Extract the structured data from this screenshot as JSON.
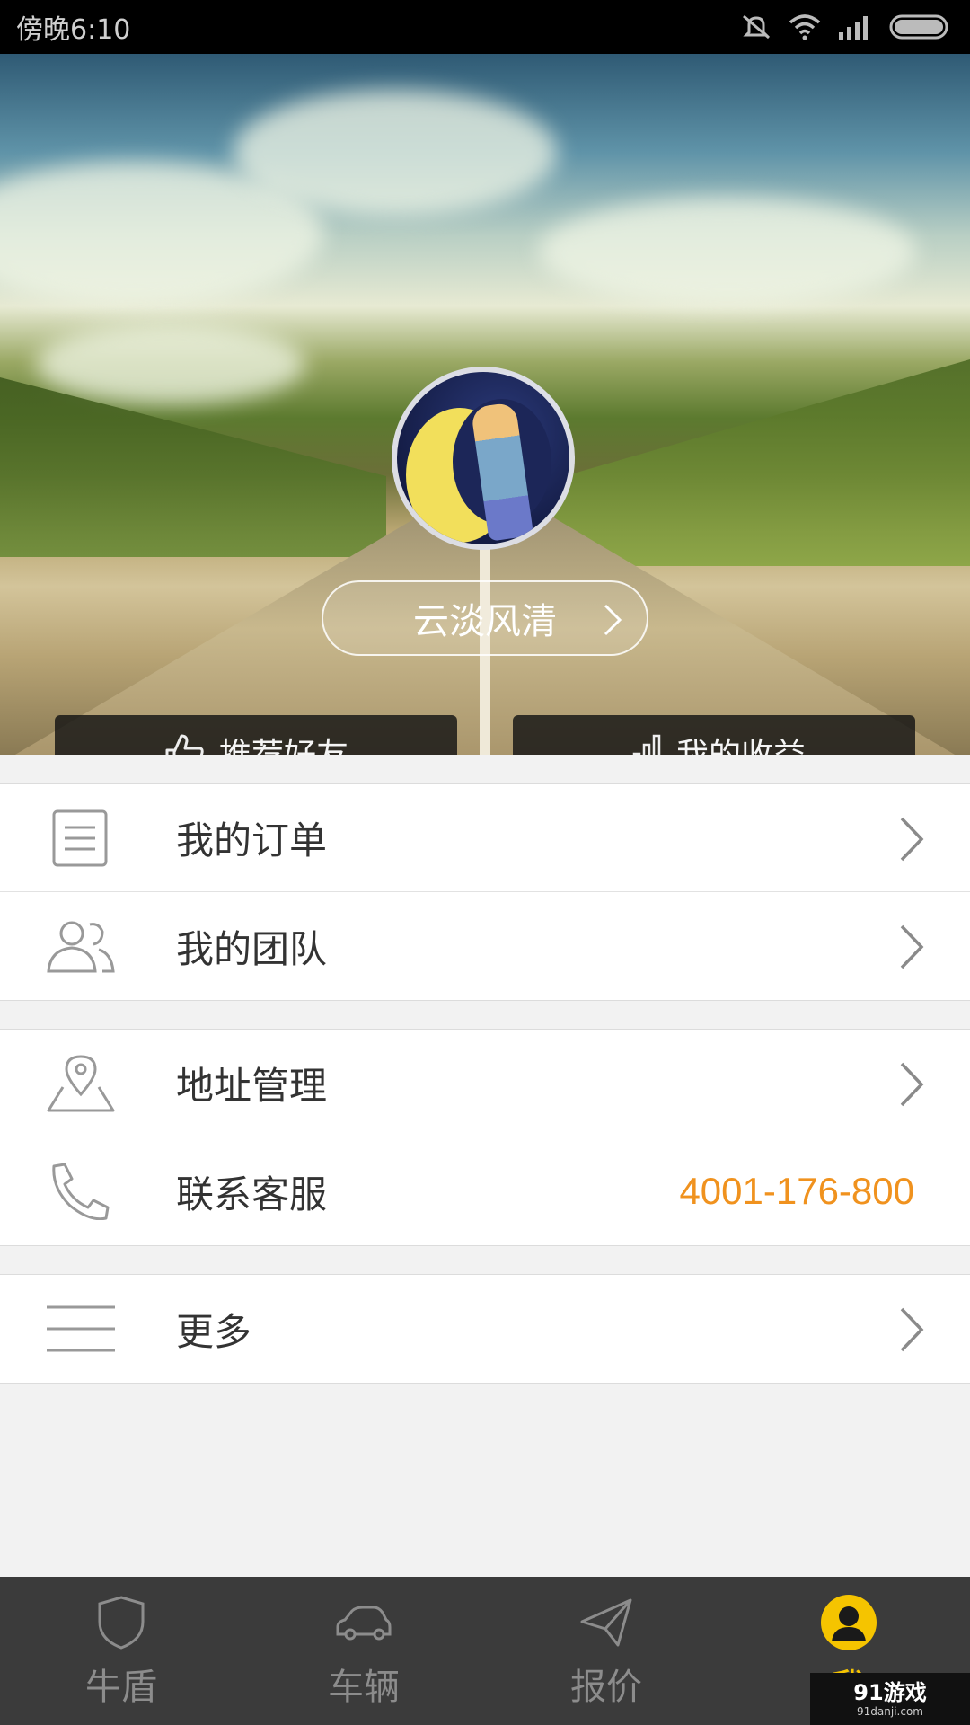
{
  "status_bar": {
    "time": "傍晚6:10",
    "icons": [
      "mute-icon",
      "wifi-icon",
      "signal-icon",
      "battery-icon"
    ]
  },
  "profile": {
    "username": "云淡风清",
    "avatar": "avatar-image"
  },
  "header_buttons": {
    "recommend": "推荐好友",
    "earnings": "我的收益"
  },
  "menu": {
    "group1": [
      {
        "label": "我的订单",
        "icon": "document-icon"
      },
      {
        "label": "我的团队",
        "icon": "team-icon"
      }
    ],
    "group2": [
      {
        "label": "地址管理",
        "icon": "location-icon"
      },
      {
        "label": "联系客服",
        "icon": "phone-icon",
        "value": "4001-176-800"
      }
    ],
    "group3": [
      {
        "label": "更多",
        "icon": "menu-lines-icon"
      }
    ]
  },
  "tabbar": {
    "tabs": [
      {
        "label": "牛盾",
        "icon": "shield-icon"
      },
      {
        "label": "车辆",
        "icon": "car-icon"
      },
      {
        "label": "报价",
        "icon": "paper-plane-icon"
      },
      {
        "label": "我",
        "icon": "user-icon",
        "active": true
      }
    ]
  },
  "watermark": {
    "brand": "91游戏",
    "url": "91danji.com"
  },
  "colors": {
    "accent": "#f5c400",
    "phone": "#f0921e",
    "tabbar_bg": "#3b3b3b"
  }
}
